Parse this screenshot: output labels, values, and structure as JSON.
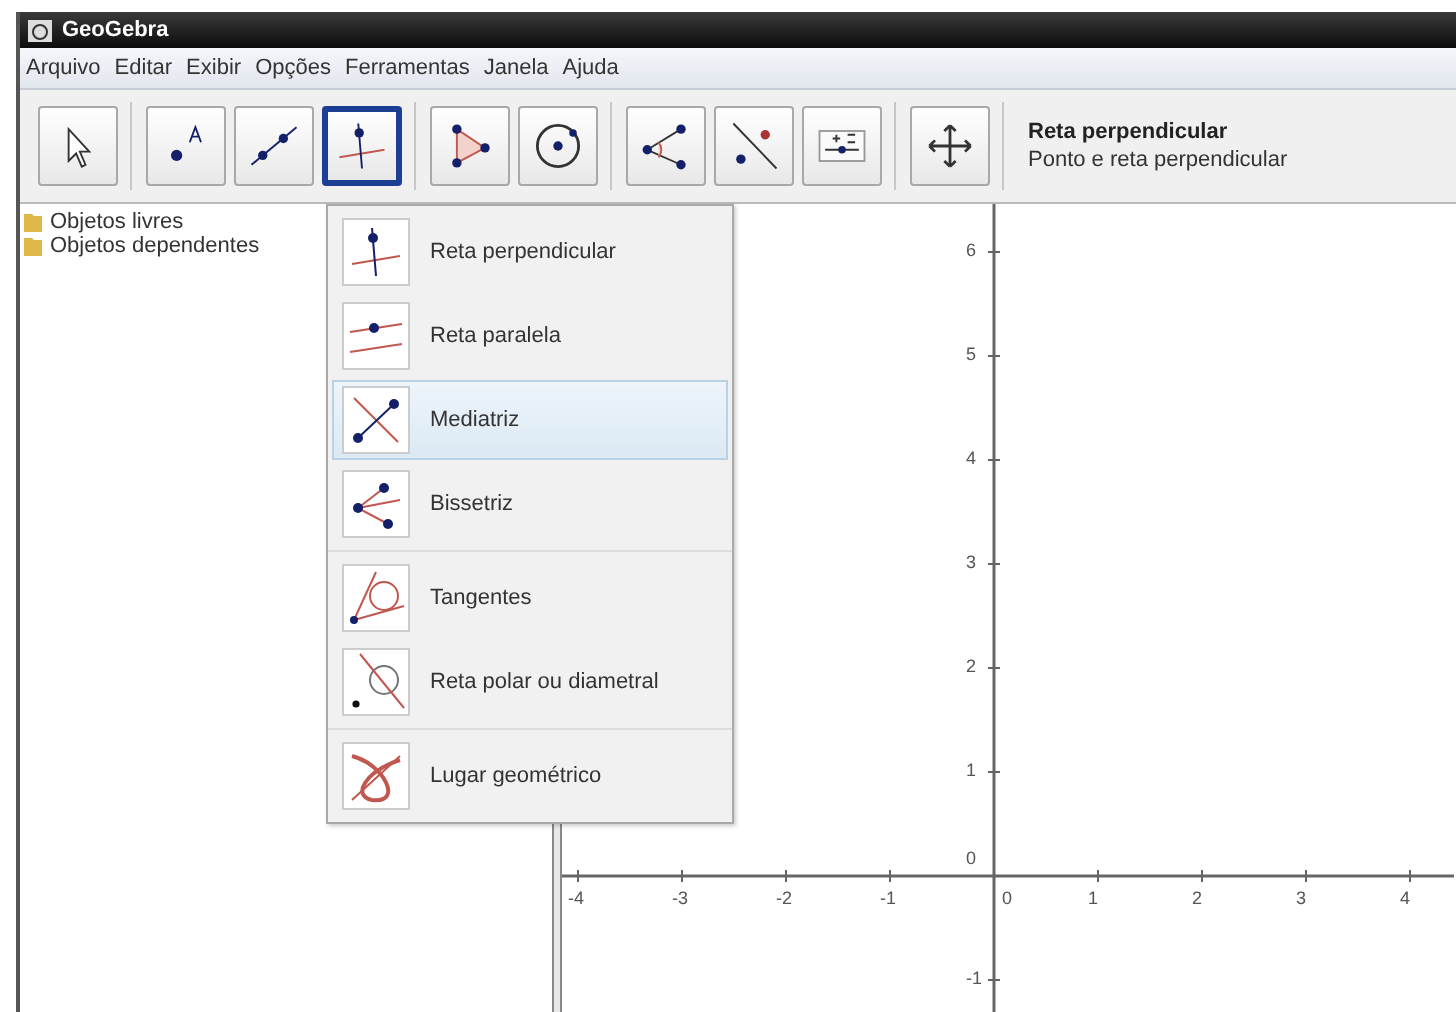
{
  "window": {
    "title": "GeoGebra"
  },
  "menu": [
    "Arquivo",
    "Editar",
    "Exibir",
    "Opções",
    "Ferramentas",
    "Janela",
    "Ajuda"
  ],
  "toolbar": {
    "groups": [
      [
        {
          "kind": "move",
          "selected": false
        }
      ],
      [
        {
          "kind": "point",
          "selected": false
        },
        {
          "kind": "line",
          "selected": false
        },
        {
          "kind": "perpendicular",
          "selected": true
        }
      ],
      [
        {
          "kind": "polygon",
          "selected": false
        },
        {
          "kind": "circle",
          "selected": false
        }
      ],
      [
        {
          "kind": "angle",
          "selected": false
        },
        {
          "kind": "reflect",
          "selected": false
        },
        {
          "kind": "slider",
          "selected": false
        }
      ],
      [
        {
          "kind": "pan",
          "selected": false
        }
      ]
    ],
    "info": {
      "title": "Reta perpendicular",
      "description": "Ponto e reta perpendicular"
    }
  },
  "algebra": {
    "items": [
      {
        "label": "Objetos livres"
      },
      {
        "label": "Objetos dependentes"
      }
    ]
  },
  "tool_menu": {
    "groups": [
      [
        {
          "kind": "perpendicular",
          "label": "Reta perpendicular",
          "selected": false
        },
        {
          "kind": "parallel",
          "label": "Reta paralela",
          "selected": false
        },
        {
          "kind": "bisector",
          "label": "Mediatriz",
          "selected": true
        },
        {
          "kind": "angle_bisector",
          "label": "Bissetriz",
          "selected": false
        }
      ],
      [
        {
          "kind": "tangents",
          "label": "Tangentes",
          "selected": false
        },
        {
          "kind": "polar",
          "label": "Reta polar ou diametral",
          "selected": false
        }
      ],
      [
        {
          "kind": "locus",
          "label": "Lugar geométrico",
          "selected": false
        }
      ]
    ]
  },
  "graphics": {
    "x_labels": [
      "-4",
      "-3",
      "-2",
      "-1",
      "0",
      "1",
      "2",
      "3",
      "4"
    ],
    "y_labels": [
      "6",
      "5",
      "4",
      "3",
      "2",
      "1",
      "0",
      "-1"
    ]
  }
}
